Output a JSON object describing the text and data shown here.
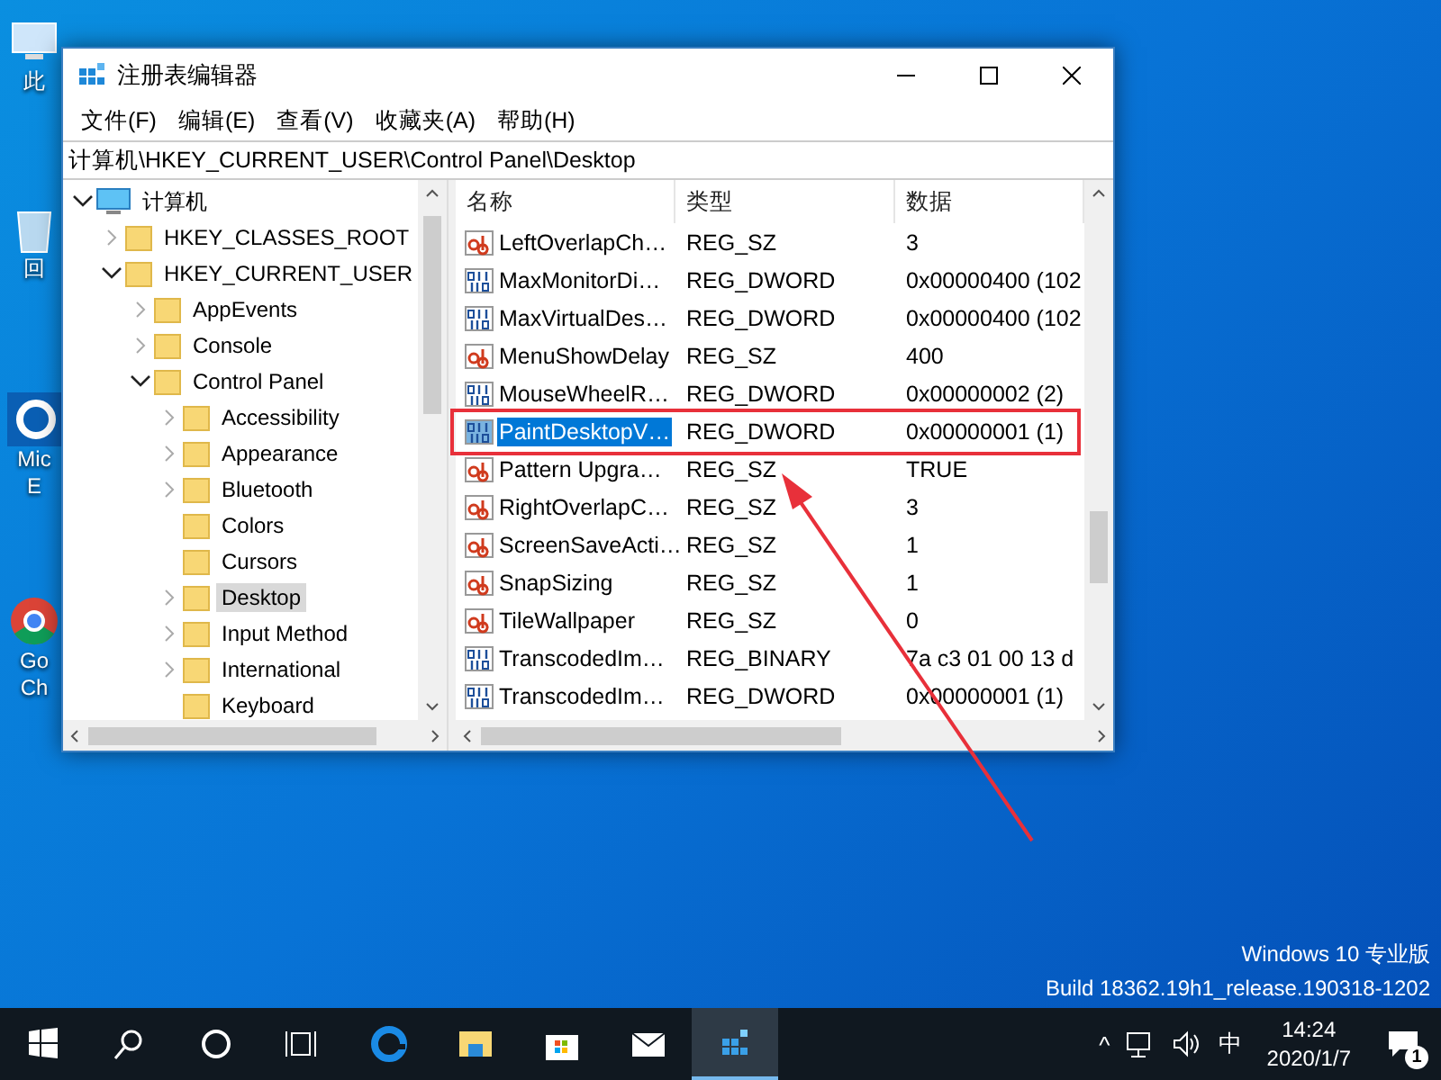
{
  "desktop_icons": [
    {
      "label": "此",
      "kind": "pc"
    },
    {
      "label": "回",
      "kind": "bin"
    },
    {
      "label": "Mic\nE",
      "kind": "edge"
    },
    {
      "label": "Go\nCh",
      "kind": "chrome"
    }
  ],
  "window": {
    "title": "注册表编辑器",
    "menu": [
      "文件(F)",
      "编辑(E)",
      "查看(V)",
      "收藏夹(A)",
      "帮助(H)"
    ],
    "address": "计算机\\HKEY_CURRENT_USER\\Control Panel\\Desktop",
    "tree": [
      {
        "label": "计算机",
        "kind": "computer",
        "expanded": true,
        "selected": false,
        "children": [
          {
            "label": "HKEY_CLASSES_ROOT",
            "kind": "folder",
            "expanded": false,
            "selected": false
          },
          {
            "label": "HKEY_CURRENT_USER",
            "kind": "folder",
            "expanded": true,
            "selected": false,
            "children": [
              {
                "label": "AppEvents",
                "kind": "folder",
                "expanded": false,
                "selected": false
              },
              {
                "label": "Console",
                "kind": "folder",
                "expanded": false,
                "selected": false
              },
              {
                "label": "Control Panel",
                "kind": "folder",
                "expanded": true,
                "selected": false,
                "children": [
                  {
                    "label": "Accessibility",
                    "kind": "folder",
                    "expanded": false,
                    "selected": false
                  },
                  {
                    "label": "Appearance",
                    "kind": "folder",
                    "expanded": false,
                    "selected": false
                  },
                  {
                    "label": "Bluetooth",
                    "kind": "folder",
                    "expanded": false,
                    "selected": false
                  },
                  {
                    "label": "Colors",
                    "kind": "leaf",
                    "selected": false
                  },
                  {
                    "label": "Cursors",
                    "kind": "leaf",
                    "selected": false
                  },
                  {
                    "label": "Desktop",
                    "kind": "folder",
                    "expanded": false,
                    "selected": true
                  },
                  {
                    "label": "Input Method",
                    "kind": "folder",
                    "expanded": false,
                    "selected": false
                  },
                  {
                    "label": "International",
                    "kind": "folder",
                    "expanded": false,
                    "selected": false
                  },
                  {
                    "label": "Keyboard",
                    "kind": "leaf",
                    "selected": false
                  }
                ]
              }
            ]
          }
        ]
      }
    ],
    "table": {
      "columns": [
        "名称",
        "类型",
        "数据"
      ],
      "rows": [
        {
          "kind": "string",
          "name": "LeftOverlapCh…",
          "type": "REG_SZ",
          "data": "3",
          "selected": false
        },
        {
          "kind": "binary",
          "name": "MaxMonitorDi…",
          "type": "REG_DWORD",
          "data": "0x00000400 (102",
          "selected": false
        },
        {
          "kind": "binary",
          "name": "MaxVirtualDes…",
          "type": "REG_DWORD",
          "data": "0x00000400 (102",
          "selected": false
        },
        {
          "kind": "string",
          "name": "MenuShowDelay",
          "type": "REG_SZ",
          "data": "400",
          "selected": false
        },
        {
          "kind": "binary",
          "name": "MouseWheelR…",
          "type": "REG_DWORD",
          "data": "0x00000002 (2)",
          "selected": false
        },
        {
          "kind": "binary",
          "name": "PaintDesktopV…",
          "type": "REG_DWORD",
          "data": "0x00000001 (1)",
          "selected": true
        },
        {
          "kind": "string",
          "name": "Pattern Upgra…",
          "type": "REG_SZ",
          "data": "TRUE",
          "selected": false
        },
        {
          "kind": "string",
          "name": "RightOverlapC…",
          "type": "REG_SZ",
          "data": "3",
          "selected": false
        },
        {
          "kind": "string",
          "name": "ScreenSaveActi…",
          "type": "REG_SZ",
          "data": "1",
          "selected": false
        },
        {
          "kind": "string",
          "name": "SnapSizing",
          "type": "REG_SZ",
          "data": "1",
          "selected": false
        },
        {
          "kind": "string",
          "name": "TileWallpaper",
          "type": "REG_SZ",
          "data": "0",
          "selected": false
        },
        {
          "kind": "binary",
          "name": "TranscodedIm…",
          "type": "REG_BINARY",
          "data": "7a c3 01 00 13 d",
          "selected": false
        },
        {
          "kind": "binary",
          "name": "TranscodedIm…",
          "type": "REG_DWORD",
          "data": "0x00000001 (1)",
          "selected": false
        }
      ]
    }
  },
  "watermark_text": [
    "Windows 10 专业版",
    "Build 18362.19h1_release.190318-1202"
  ],
  "taskbar": {
    "apps": [
      {
        "kind": "start"
      },
      {
        "kind": "search"
      },
      {
        "kind": "cortana"
      },
      {
        "kind": "taskview"
      },
      {
        "kind": "edge"
      },
      {
        "kind": "explorer"
      },
      {
        "kind": "store"
      },
      {
        "kind": "mail"
      },
      {
        "kind": "regedit",
        "selected": true
      }
    ],
    "tray": {
      "chevron": "^",
      "ime": "中",
      "time": "14:24",
      "date": "2020/1/7",
      "notifications": "1"
    }
  }
}
